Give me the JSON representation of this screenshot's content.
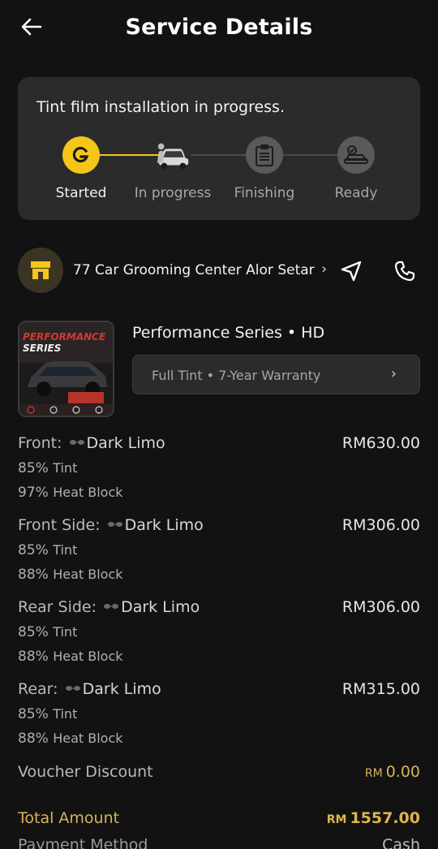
{
  "header": {
    "title": "Service Details"
  },
  "progress": {
    "message": "Tint film installation in progress.",
    "steps": [
      {
        "label": "Started",
        "icon": "g-logo-icon",
        "state": "done"
      },
      {
        "label": "In progress",
        "icon": "car-installer-icon",
        "state": "current"
      },
      {
        "label": "Finishing",
        "icon": "clipboard-icon",
        "state": "pending"
      },
      {
        "label": "Ready",
        "icon": "car-check-icon",
        "state": "pending"
      }
    ],
    "accent": "#f5c518"
  },
  "shop": {
    "name": "77 Car Grooming Center Alor Setar",
    "chevron": "›"
  },
  "product": {
    "image_text": [
      "PERFORMANCE",
      "SERIES"
    ],
    "name": "Performance Series • HD",
    "option": "Full Tint • 7-Year Warranty",
    "option_chevron": "›"
  },
  "items": [
    {
      "position": "Front:",
      "film": "Dark Limo",
      "price": "RM630.00",
      "tint_value": "85%",
      "tint_label": "Tint",
      "heat_value": "97%",
      "heat_label": "Heat Block"
    },
    {
      "position": "Front Side:",
      "film": "Dark Limo",
      "price": "RM306.00",
      "tint_value": "85%",
      "tint_label": "Tint",
      "heat_value": "88%",
      "heat_label": "Heat Block"
    },
    {
      "position": "Rear Side:",
      "film": "Dark Limo",
      "price": "RM306.00",
      "tint_value": "85%",
      "tint_label": "Tint",
      "heat_value": "88%",
      "heat_label": "Heat Block"
    },
    {
      "position": "Rear:",
      "film": "Dark Limo",
      "price": "RM315.00",
      "tint_value": "85%",
      "tint_label": "Tint",
      "heat_value": "88%",
      "heat_label": "Heat Block"
    }
  ],
  "voucher": {
    "label": "Voucher Discount",
    "currency": "RM",
    "amount": "0.00"
  },
  "total": {
    "label": "Total Amount",
    "currency": "RM",
    "amount": "1557.00"
  },
  "payment": {
    "label": "Payment Method",
    "value": "Cash"
  },
  "colors": {
    "background": "#121212",
    "card": "#2b2b2b",
    "gold": "#d9b25a"
  }
}
